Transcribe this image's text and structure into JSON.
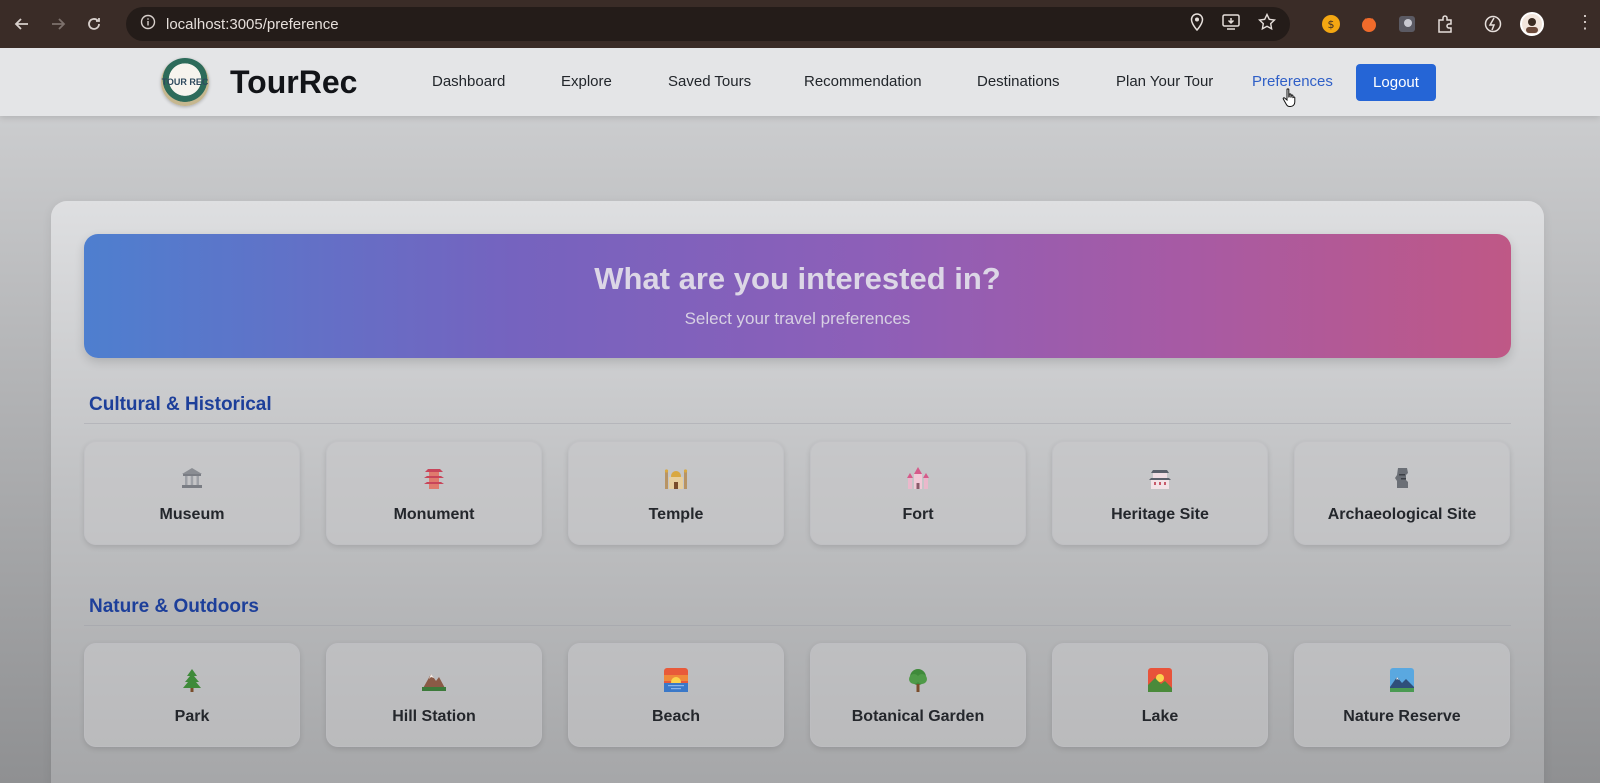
{
  "browser": {
    "url": "localhost:3005/preference",
    "icons": [
      "back-icon",
      "forward-icon",
      "reload-icon",
      "site-info-icon",
      "location-icon",
      "install-app-icon",
      "star-icon",
      "extension-icon",
      "menu-icon"
    ]
  },
  "navbar": {
    "logo_text": "TOUR REC",
    "brand": "TourRec",
    "links": [
      {
        "label": "Dashboard"
      },
      {
        "label": "Explore"
      },
      {
        "label": "Saved Tours"
      },
      {
        "label": "Recommendation"
      },
      {
        "label": "Destinations"
      },
      {
        "label": "Plan Your Tour"
      },
      {
        "label": "Preferences",
        "active": true
      }
    ],
    "logout_label": "Logout",
    "active_color": "#2f5fc7",
    "logout_color": "#2565d6"
  },
  "hero": {
    "title": "What are you interested in?",
    "subtitle": "Select your travel preferences"
  },
  "sections": [
    {
      "title": "Cultural & Historical",
      "items": [
        {
          "label": "Museum",
          "icon": "museum-icon"
        },
        {
          "label": "Monument",
          "icon": "pagoda-icon"
        },
        {
          "label": "Temple",
          "icon": "mosque-icon"
        },
        {
          "label": "Fort",
          "icon": "castle-icon"
        },
        {
          "label": "Heritage Site",
          "icon": "japanese-castle-icon"
        },
        {
          "label": "Archaeological Site",
          "icon": "moai-icon"
        }
      ]
    },
    {
      "title": "Nature & Outdoors",
      "items": [
        {
          "label": "Park",
          "icon": "evergreen-tree-icon"
        },
        {
          "label": "Hill Station",
          "icon": "mountain-icon"
        },
        {
          "label": "Beach",
          "icon": "sunset-icon"
        },
        {
          "label": "Botanical Garden",
          "icon": "deciduous-tree-icon"
        },
        {
          "label": "Lake",
          "icon": "sunrise-mountain-icon"
        },
        {
          "label": "Nature Reserve",
          "icon": "landscape-icon"
        }
      ]
    }
  ]
}
